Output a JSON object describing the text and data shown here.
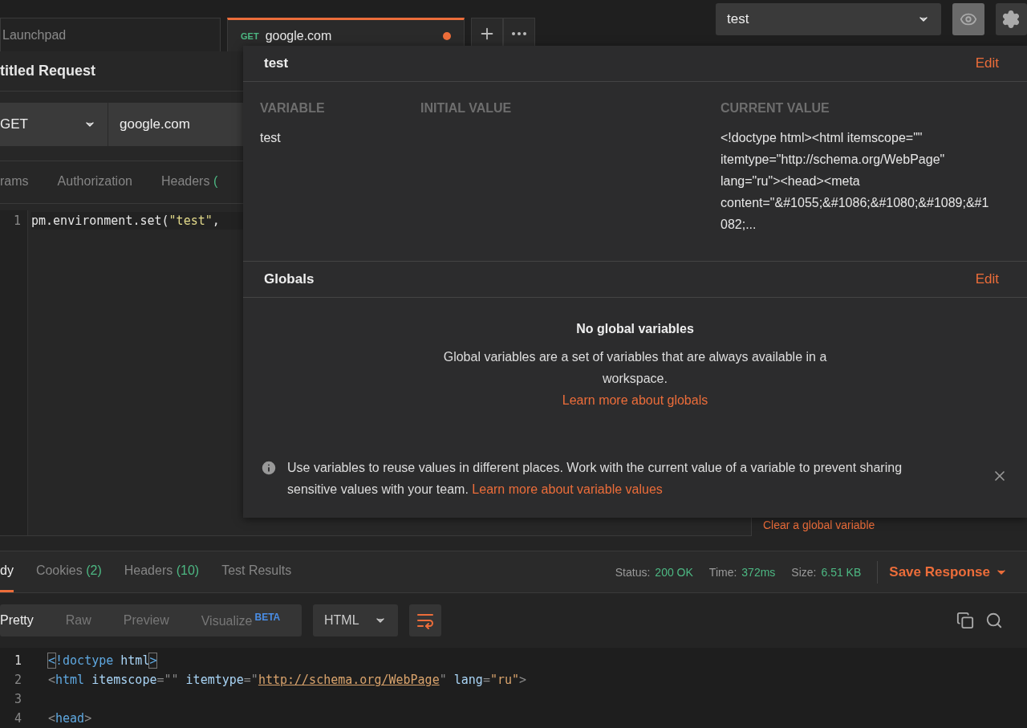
{
  "tabs": [
    {
      "label": "Launchpad",
      "selected": false,
      "unsaved": false
    },
    {
      "method": "GET",
      "label": "google.com",
      "selected": true,
      "unsaved": true
    }
  ],
  "environment": {
    "selected": "test"
  },
  "request": {
    "title": "titled Request",
    "method": "GET",
    "url": "google.com",
    "tabs": [
      {
        "label": "rams",
        "selected": false
      },
      {
        "label": "Authorization",
        "selected": false
      },
      {
        "label": "Headers",
        "count": "(",
        "selected": false
      }
    ],
    "script": [
      {
        "number": "1",
        "tokens": [
          {
            "kind": "plain",
            "text": "pm.environment.set("
          },
          {
            "kind": "string",
            "text": "\"test\""
          },
          {
            "kind": "plain",
            "text": ", "
          }
        ]
      }
    ]
  },
  "sidebar": {
    "link": "Clear a global variable"
  },
  "popup": {
    "environment": {
      "name": "test",
      "edit": "Edit",
      "columns": [
        "VARIABLE",
        "INITIAL VALUE",
        "CURRENT VALUE"
      ],
      "rows": [
        {
          "variable": "test",
          "current_value": "<!doctype html><html itemscope=\"\" itemtype=\"http://schema.org/WebPage\" lang=\"ru\"><head><meta content=\"&#1055;&#1086;&#1080;&#1089;&#1082;..."
        }
      ]
    },
    "globals": {
      "title": "Globals",
      "edit": "Edit",
      "empty_title": "No global variables",
      "empty_text": "Global variables are a set of variables that are always available in a workspace.",
      "link": "Learn more about globals"
    },
    "info": {
      "text": "Use variables to reuse values in different places. Work with the current value of a variable to prevent sharing sensitive values with your team.",
      "link": "Learn more about variable values"
    }
  },
  "response": {
    "tabs": [
      {
        "label": "dy",
        "selected": true
      },
      {
        "label": "Cookies",
        "count": "(2)",
        "selected": false
      },
      {
        "label": "Headers",
        "count": "(10)",
        "selected": false
      },
      {
        "label": "Test Results",
        "selected": false
      }
    ],
    "stats": [
      {
        "label": "Status:",
        "value": "200 OK"
      },
      {
        "label": "Time:",
        "value": "372ms"
      },
      {
        "label": "Size:",
        "value": "6.51 KB"
      }
    ],
    "save": "Save Response",
    "views": [
      {
        "label": "Pretty",
        "selected": true
      },
      {
        "label": "Raw",
        "selected": false
      },
      {
        "label": "Preview",
        "selected": false
      },
      {
        "label": "Visualize",
        "badge": "BETA",
        "selected": false
      }
    ],
    "format": "HTML",
    "wrap_on": true,
    "lines": [
      {
        "number": "1",
        "tokens": [
          {
            "kind": "match",
            "text": "<"
          },
          {
            "kind": "tag",
            "text": "!doctype"
          },
          {
            "kind": "attr",
            "text": " html"
          },
          {
            "kind": "match",
            "text": ">"
          }
        ]
      },
      {
        "number": "2",
        "tokens": [
          {
            "kind": "punct",
            "text": "<"
          },
          {
            "kind": "tag",
            "text": "html"
          },
          {
            "kind": "attr",
            "text": " itemscope"
          },
          {
            "kind": "punct",
            "text": "=\"\""
          },
          {
            "kind": "attr",
            "text": " itemtype"
          },
          {
            "kind": "punct",
            "text": "=\""
          },
          {
            "kind": "link",
            "text": "http://schema.org/WebPage"
          },
          {
            "kind": "punct",
            "text": "\""
          },
          {
            "kind": "attr",
            "text": " lang"
          },
          {
            "kind": "punct",
            "text": "="
          },
          {
            "kind": "string",
            "text": "\"ru\""
          },
          {
            "kind": "punct",
            "text": ">"
          }
        ]
      },
      {
        "number": "3"
      },
      {
        "number": "4",
        "tokens": [
          {
            "kind": "punct",
            "text": "<"
          },
          {
            "kind": "tag",
            "text": "head"
          },
          {
            "kind": "punct",
            "text": ">"
          }
        ]
      }
    ]
  }
}
